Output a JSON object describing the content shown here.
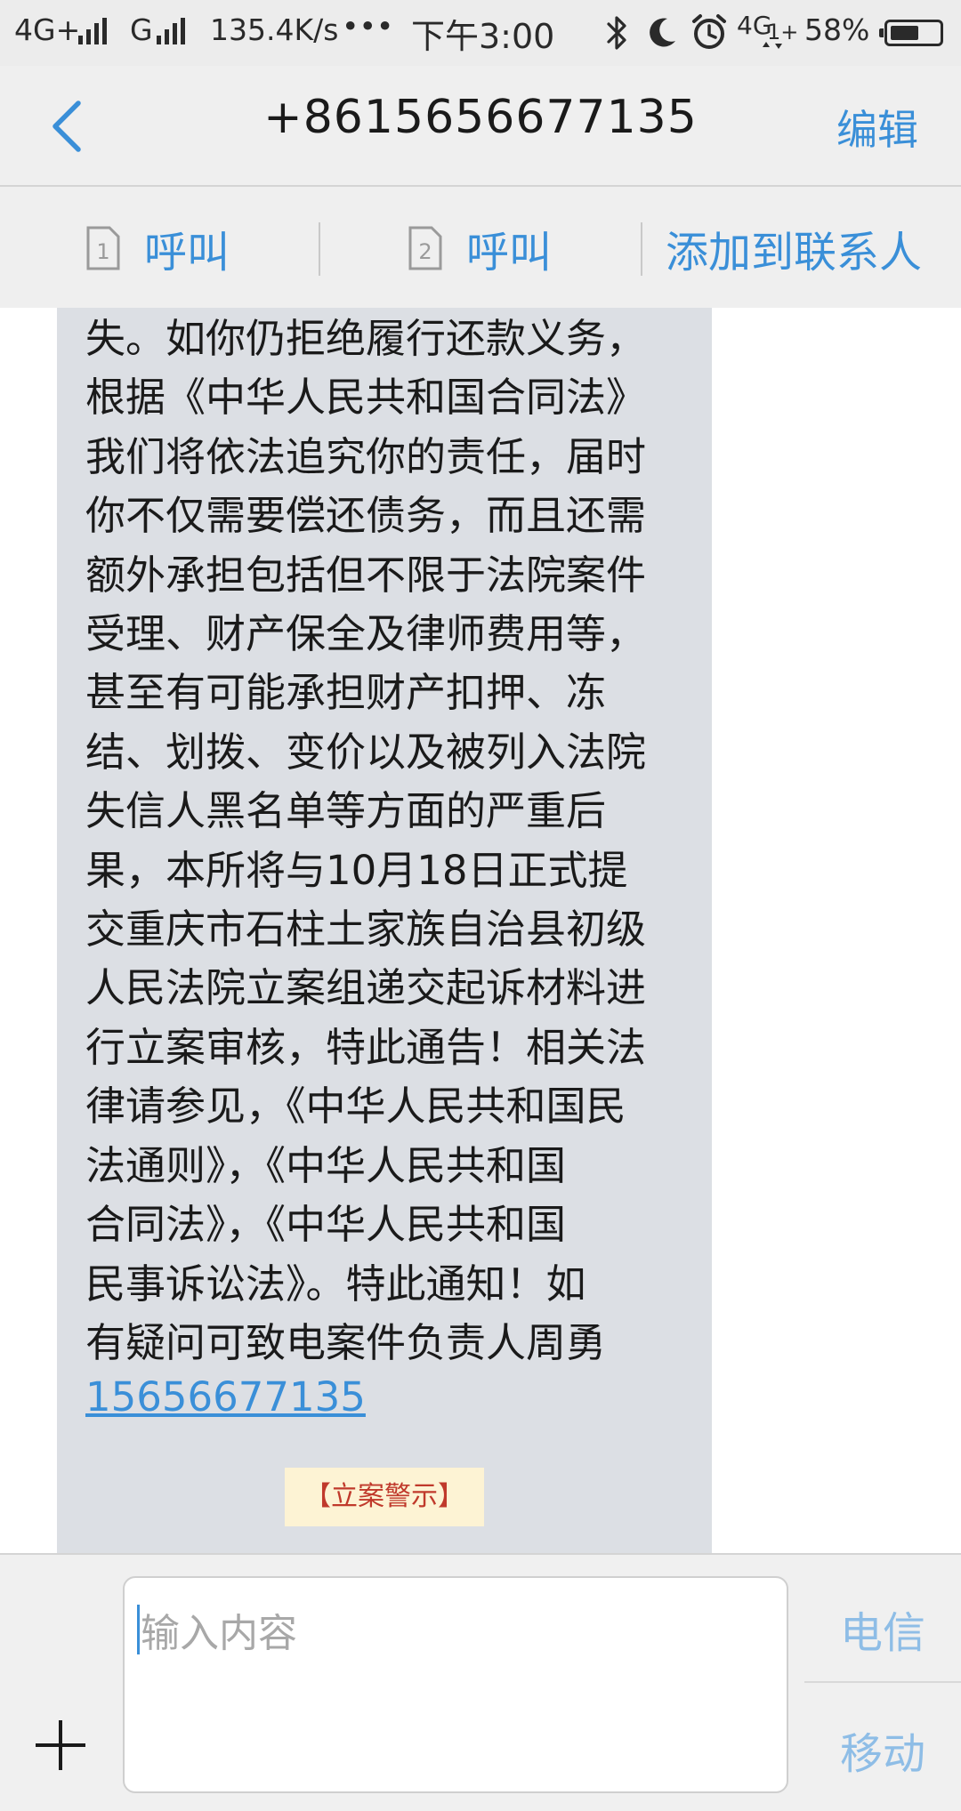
{
  "status_bar": {
    "network_1": "4G+",
    "network_2": "G",
    "speed": "135.4K/s",
    "more": "•••",
    "time": "下午3:00",
    "network_3": "4G",
    "network_3_suffix": "1+",
    "battery": "58%",
    "battery_level": 0.58
  },
  "nav": {
    "title": "+8615656677135",
    "edit_label": "编辑"
  },
  "actions": {
    "call_sim1_label": "呼叫",
    "sim1_number": "1",
    "call_sim2_label": "呼叫",
    "sim2_number": "2",
    "add_contact_label": "添加到联系人"
  },
  "message": {
    "lines": [
      "失。如你仍拒绝履行还款义务，",
      "根据《中华人民共和国合同法》",
      "我们将依法追究你的责任，届时",
      "你不仅需要偿还债务，而且还需",
      "额外承担包括但不限于法院案件",
      "受理、财产保全及律师费用等，",
      "甚至有可能承担财产扣押、冻",
      "结、划拨、变价以及被列入法院",
      "失信人黑名单等方面的严重后",
      "果，本所将与10月18日正式提",
      "交重庆市石柱土家族自治县初级",
      "人民法院立案组递交起诉材料进",
      "行立案审核，特此通告！相关法",
      "律请参见，《中华人民共和国民",
      "法通则》，《中华人民共和国",
      "合同法》，《中华人民共和国",
      "民事诉讼法》。特此通知！如",
      "有疑问可致电案件负责人周勇"
    ],
    "phone": "15656677135",
    "tag": "【立案警示】"
  },
  "composer": {
    "placeholder": "输入内容",
    "carrier_1": "电信",
    "carrier_2": "移动"
  }
}
